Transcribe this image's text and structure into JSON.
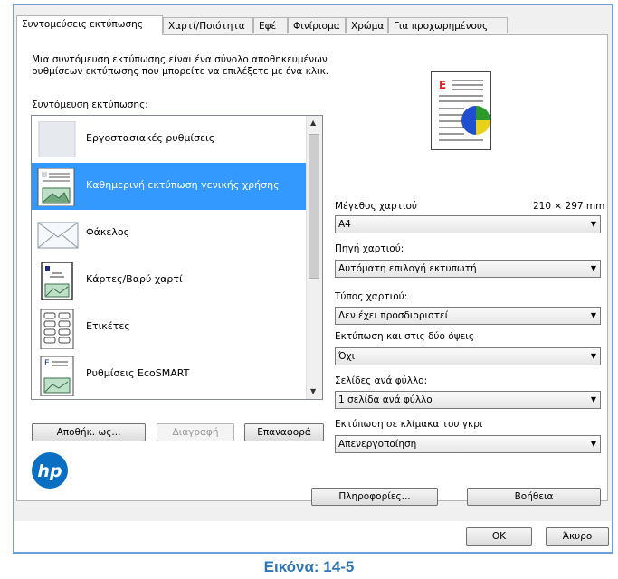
{
  "tabs": [
    {
      "label": "Συντομεύσεις εκτύπωσης",
      "active": true
    },
    {
      "label": "Χαρτί/Ποιότητα",
      "active": false
    },
    {
      "label": "Εφέ",
      "active": false
    },
    {
      "label": "Φινίρισμα",
      "active": false
    },
    {
      "label": "Χρώμα",
      "active": false
    },
    {
      "label": "Για προχωρημένους",
      "active": false
    }
  ],
  "description": "Μια συντόμευση εκτύπωσης είναι ένα σύνολο αποθηκευμένων ρυθμίσεων εκτύπωσης που μπορείτε να επιλέξετε με ένα κλικ.",
  "shortcuts_label": "Συντόμευση εκτύπωσης:",
  "shortcuts": [
    {
      "label": "Εργοστασιακές ρυθμίσεις",
      "icon": "blank-page-icon",
      "selected": false
    },
    {
      "label": "Καθημερινή εκτύπωση γενικής χρήσης",
      "icon": "document-photo-icon",
      "selected": true
    },
    {
      "label": "Φάκελος",
      "icon": "envelope-icon",
      "selected": false
    },
    {
      "label": "Κάρτες/Βαρύ χαρτί",
      "icon": "card-icon",
      "selected": false
    },
    {
      "label": "Ετικέτες",
      "icon": "labels-icon",
      "selected": false
    },
    {
      "label": "Ρυθμίσεις EcoSMART",
      "icon": "ecosmart-icon",
      "selected": false
    }
  ],
  "buttons": {
    "save_as": "Αποθήκ. ως...",
    "delete": "Διαγραφή",
    "reset": "Επαναφορά",
    "info": "Πληροφορίες...",
    "help": "Βοήθεια",
    "ok": "OK",
    "cancel": "Άκυρο"
  },
  "preview_letter": "E",
  "settings": {
    "paper_size_label": "Μέγεθος χαρτιού",
    "paper_size_dims": "210 × 297 mm",
    "paper_size_value": "A4",
    "paper_source_label": "Πηγή χαρτιού:",
    "paper_source_value": "Αυτόματη επιλογή εκτυπωτή",
    "paper_type_label": "Τύπος χαρτιού:",
    "paper_type_value": "Δεν έχει προσδιοριστεί",
    "duplex_label": "Εκτύπωση και στις δύο όψεις",
    "duplex_value": "Όχι",
    "pages_per_sheet_label": "Σελίδες ανά φύλλο:",
    "pages_per_sheet_value": "1 σελίδα ανά φύλλο",
    "grayscale_label": "Εκτύπωση σε κλίμακα του γκρι",
    "grayscale_value": "Απενεργοποίηση"
  },
  "logo_text": "hp",
  "caption": "Εικόνα: 14-5"
}
